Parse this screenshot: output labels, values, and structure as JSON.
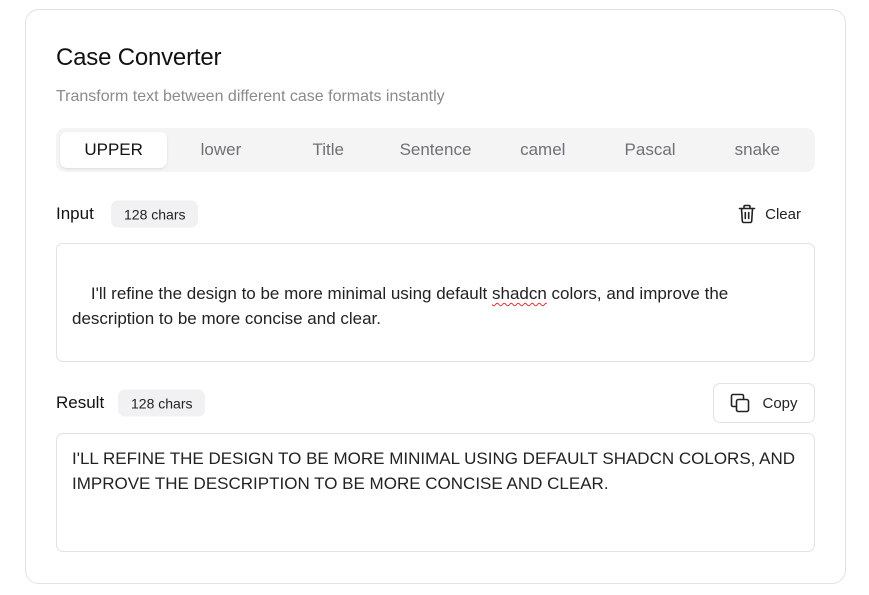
{
  "header": {
    "title": "Case Converter",
    "subtitle": "Transform text between different case formats instantly"
  },
  "tabs": [
    {
      "label": "UPPER",
      "active": true
    },
    {
      "label": "lower",
      "active": false
    },
    {
      "label": "Title",
      "active": false
    },
    {
      "label": "Sentence",
      "active": false
    },
    {
      "label": "camel",
      "active": false
    },
    {
      "label": "Pascal",
      "active": false
    },
    {
      "label": "snake",
      "active": false
    }
  ],
  "input": {
    "label": "Input",
    "count": "128 chars",
    "clear_label": "Clear",
    "value": "I'll refine the design to be more minimal using default shadcn colors, and improve the description to be more concise and clear."
  },
  "result": {
    "label": "Result",
    "count": "128 chars",
    "copy_label": "Copy",
    "value": "I'LL REFINE THE DESIGN TO BE MORE MINIMAL USING DEFAULT SHADCN COLORS, AND IMPROVE THE DESCRIPTION TO BE MORE CONCISE AND CLEAR."
  },
  "icons": {
    "clear": "trash-icon",
    "copy": "copy-icon"
  },
  "colors": {
    "muted_text": "#8a8a8f",
    "tab_bg": "#f4f4f5",
    "border": "#e2e2e5",
    "spellcheck": "#e03030"
  }
}
